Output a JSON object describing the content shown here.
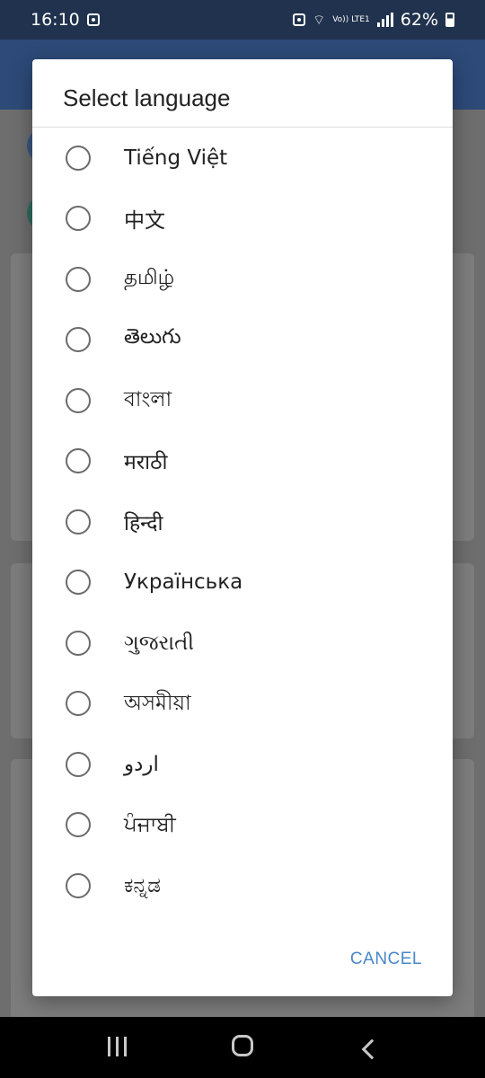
{
  "status_bar": {
    "time": "16:10",
    "lte": "Vo)) LTE1",
    "battery": "62%"
  },
  "dialog": {
    "title": "Select language",
    "options": [
      {
        "label": "Tiếng Việt",
        "selected": false
      },
      {
        "label": "中文",
        "selected": false
      },
      {
        "label": "தமிழ்",
        "selected": false
      },
      {
        "label": "తెలుగు",
        "selected": false
      },
      {
        "label": "বাংলা",
        "selected": false
      },
      {
        "label": "मराठी",
        "selected": false
      },
      {
        "label": "हिन्दी",
        "selected": false
      },
      {
        "label": "Українська",
        "selected": false
      },
      {
        "label": "ગુજરાતી",
        "selected": false
      },
      {
        "label": "অসমীয়া",
        "selected": false
      },
      {
        "label": "اردو",
        "selected": false
      },
      {
        "label": "ਪੰਜਾਬੀ",
        "selected": false
      },
      {
        "label": "ಕನ್ನಡ",
        "selected": false
      }
    ],
    "cancel_label": "CANCEL"
  },
  "colors": {
    "accent": "#4a86c8",
    "app_bar": "#2d4a78",
    "status_bar": "#20324d"
  }
}
